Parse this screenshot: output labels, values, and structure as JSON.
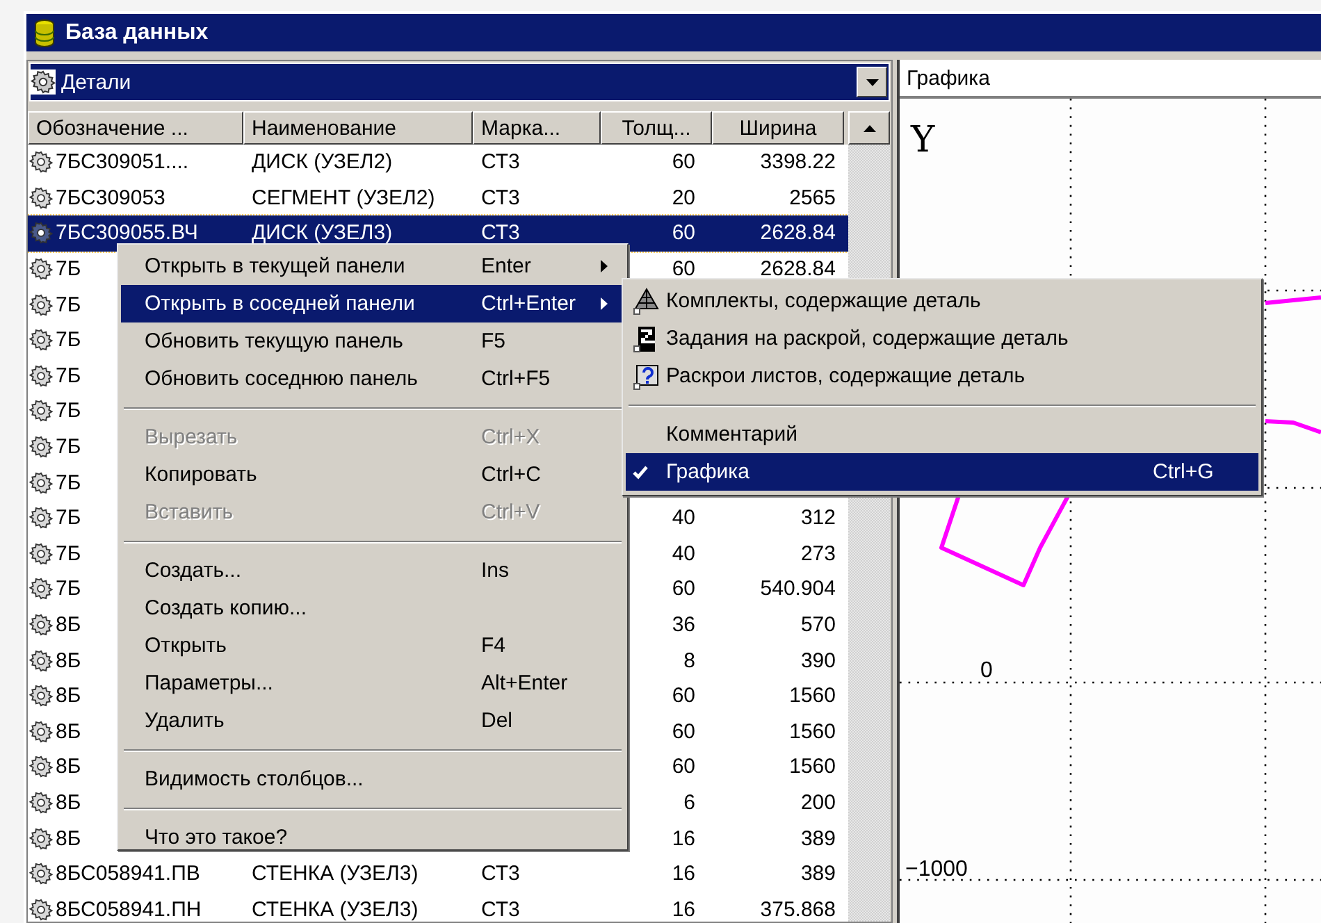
{
  "window": {
    "title": "База данных"
  },
  "left_panel": {
    "view": "Детали",
    "columns": [
      "Обозначение ...",
      "Наименование",
      "Марка...",
      "Толщ...",
      "Ширина"
    ],
    "rows": [
      {
        "cells": [
          "7БС309051....",
          "ДИСК (УЗЕЛ2)",
          "СТ3",
          "60",
          "3398.22"
        ],
        "selected": false
      },
      {
        "cells": [
          "7БС309053",
          "СЕГМЕНТ (УЗЕЛ2)",
          "СТ3",
          "20",
          "2565"
        ],
        "selected": false
      },
      {
        "cells": [
          "7БС309055.ВЧ",
          "ДИСК (УЗЕЛ3)",
          "СТ3",
          "60",
          "2628.84"
        ],
        "selected": true
      },
      {
        "cells": [
          "7Б",
          null,
          null,
          "60",
          "2628.84"
        ],
        "selected": false
      },
      {
        "cells": [
          "7Б",
          null,
          null,
          null,
          null
        ],
        "selected": false
      },
      {
        "cells": [
          "7Б",
          null,
          null,
          null,
          null
        ],
        "selected": false
      },
      {
        "cells": [
          "7Б",
          null,
          null,
          null,
          null
        ],
        "selected": false
      },
      {
        "cells": [
          "7Б",
          null,
          null,
          null,
          null
        ],
        "selected": false
      },
      {
        "cells": [
          "7Б",
          null,
          null,
          null,
          null
        ],
        "selected": false
      },
      {
        "cells": [
          "7Б",
          null,
          null,
          null,
          null
        ],
        "selected": false
      },
      {
        "cells": [
          "7Б",
          null,
          null,
          "40",
          "312"
        ],
        "selected": false
      },
      {
        "cells": [
          "7Б",
          null,
          null,
          "40",
          "273"
        ],
        "selected": false
      },
      {
        "cells": [
          "7Б",
          null,
          null,
          "60",
          "540.904"
        ],
        "selected": false
      },
      {
        "cells": [
          "8Б",
          null,
          null,
          "36",
          "570"
        ],
        "selected": false
      },
      {
        "cells": [
          "8Б",
          null,
          null,
          "8",
          "390"
        ],
        "selected": false
      },
      {
        "cells": [
          "8Б",
          null,
          null,
          "60",
          "1560"
        ],
        "selected": false
      },
      {
        "cells": [
          "8Б",
          null,
          null,
          "60",
          "1560"
        ],
        "selected": false
      },
      {
        "cells": [
          "8Б",
          null,
          null,
          "60",
          "1560"
        ],
        "selected": false
      },
      {
        "cells": [
          "8Б",
          null,
          null,
          "6",
          "200"
        ],
        "selected": false
      },
      {
        "cells": [
          "8Б",
          null,
          null,
          "16",
          "389"
        ],
        "selected": false
      },
      {
        "cells": [
          "8БС058941.ПВ",
          "СТЕНКА (УЗЕЛ3)",
          "СТ3",
          "16",
          "389"
        ],
        "selected": false
      },
      {
        "cells": [
          "8БС058941.ПН",
          "СТЕНКА (УЗЕЛ3)",
          "СТ3",
          "16",
          "375.868"
        ],
        "selected": false
      }
    ]
  },
  "context_menu": {
    "items": [
      {
        "kind": "item",
        "label": "Открыть в текущей панели",
        "shortcut": "Enter",
        "submenu": true,
        "disabled": false,
        "selected": false
      },
      {
        "kind": "item",
        "label": "Открыть в соседней панели",
        "shortcut": "Ctrl+Enter",
        "submenu": true,
        "disabled": false,
        "selected": true
      },
      {
        "kind": "item",
        "label": "Обновить текущую панель",
        "shortcut": "F5",
        "submenu": false,
        "disabled": false,
        "selected": false
      },
      {
        "kind": "item",
        "label": "Обновить соседнюю панель",
        "shortcut": "Ctrl+F5",
        "submenu": false,
        "disabled": false,
        "selected": false
      },
      {
        "kind": "separator"
      },
      {
        "kind": "item",
        "label": "Вырезать",
        "shortcut": "Ctrl+X",
        "submenu": false,
        "disabled": true,
        "selected": false
      },
      {
        "kind": "item",
        "label": "Копировать",
        "shortcut": "Ctrl+C",
        "submenu": false,
        "disabled": false,
        "selected": false
      },
      {
        "kind": "item",
        "label": "Вставить",
        "shortcut": "Ctrl+V",
        "submenu": false,
        "disabled": true,
        "selected": false
      },
      {
        "kind": "separator"
      },
      {
        "kind": "item",
        "label": "Создать...",
        "shortcut": "Ins",
        "submenu": false,
        "disabled": false,
        "selected": false
      },
      {
        "kind": "item",
        "label": "Создать копию...",
        "submenu": false,
        "disabled": false,
        "selected": false
      },
      {
        "kind": "item",
        "label": "Открыть",
        "shortcut": "F4",
        "submenu": false,
        "disabled": false,
        "selected": false
      },
      {
        "kind": "item",
        "label": "Параметры...",
        "shortcut": "Alt+Enter",
        "submenu": false,
        "disabled": false,
        "selected": false
      },
      {
        "kind": "item",
        "label": "Удалить",
        "shortcut": "Del",
        "submenu": false,
        "disabled": false,
        "selected": false
      },
      {
        "kind": "separator"
      },
      {
        "kind": "item",
        "label": "Видимость столбцов...",
        "submenu": false,
        "disabled": false,
        "selected": false
      },
      {
        "kind": "separator"
      },
      {
        "kind": "item",
        "label": "Что это такое?",
        "submenu": false,
        "disabled": false,
        "selected": false
      }
    ]
  },
  "submenu": {
    "items": [
      {
        "kind": "item",
        "label": "Комплекты, содержащие деталь",
        "checked": false,
        "selected": false
      },
      {
        "kind": "item",
        "label": "Задания на раскрой, содержащие деталь",
        "checked": false,
        "selected": false
      },
      {
        "kind": "item",
        "label": "Раскрои листов, содержащие деталь",
        "checked": false,
        "selected": false
      },
      {
        "kind": "separator"
      },
      {
        "kind": "item",
        "label": "Комментарий",
        "checked": false,
        "selected": false
      },
      {
        "kind": "item",
        "label": "Графика",
        "shortcut": "Ctrl+G",
        "checked": true,
        "selected": true
      }
    ]
  },
  "right_panel": {
    "view": "Графика",
    "axis_label": "Y",
    "tick_labels": [
      "0",
      "−1000"
    ]
  }
}
